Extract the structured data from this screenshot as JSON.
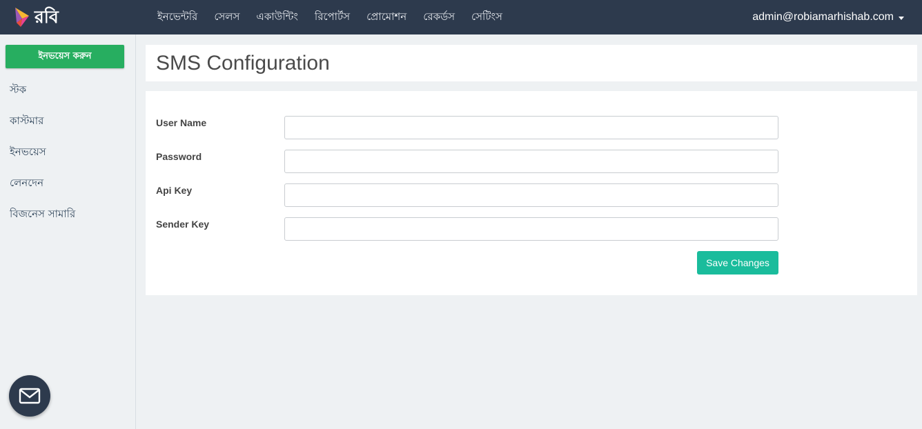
{
  "brand": {
    "name": "রবি"
  },
  "nav": {
    "items": [
      {
        "label": "ইনভেন্টরি"
      },
      {
        "label": "সেলস"
      },
      {
        "label": "একাউন্টিং"
      },
      {
        "label": "রিপোর্টস"
      },
      {
        "label": "প্রোমোশন"
      },
      {
        "label": "রেকর্ডস"
      },
      {
        "label": "সেটিংস"
      }
    ],
    "user_email": "admin@robiamarhishab.com"
  },
  "sidebar": {
    "invoice_button": "ইনভয়েস করুন",
    "items": [
      {
        "label": "স্টক"
      },
      {
        "label": "কাস্টমার"
      },
      {
        "label": "ইনভয়েস"
      },
      {
        "label": "লেনদেন"
      },
      {
        "label": "বিজনেস সামারি"
      }
    ]
  },
  "page": {
    "title": "SMS Configuration"
  },
  "form": {
    "fields": [
      {
        "label": "User Name",
        "value": ""
      },
      {
        "label": "Password",
        "value": ""
      },
      {
        "label": "Api Key",
        "value": ""
      },
      {
        "label": "Sender Key",
        "value": ""
      }
    ],
    "save_label": "Save Changes"
  },
  "icons": {
    "mail": "mail-icon",
    "dropdown": "caret-down-icon",
    "logo": "robi-logo"
  },
  "colors": {
    "topbar": "#2d3a4d",
    "invoice_button": "#27ae60",
    "save_button": "#1abc9c"
  }
}
